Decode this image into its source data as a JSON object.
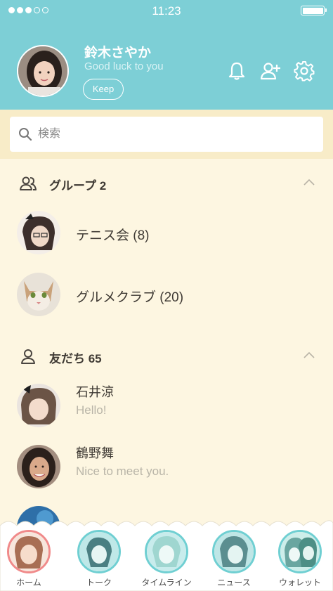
{
  "status_bar": {
    "time": "11:23",
    "signal_filled": 3,
    "signal_total": 5,
    "battery_level": 1.0
  },
  "profile": {
    "name": "鈴木さやか",
    "status_message": "Good luck to you",
    "keep_label": "Keep",
    "icons": [
      "bell-icon",
      "add-friend-icon",
      "gear-icon"
    ]
  },
  "search": {
    "placeholder": "検索",
    "value": ""
  },
  "groups": {
    "header": "グループ 2",
    "items": [
      {
        "label": "テニス会 (8)"
      },
      {
        "label": "グルメクラブ (20)"
      }
    ]
  },
  "friends": {
    "header": "友だち 65",
    "items": [
      {
        "name": "石井涼",
        "message": "Hello!"
      },
      {
        "name": "鶴野舞",
        "message": "Nice to meet you."
      }
    ]
  },
  "bottom_nav": {
    "items": [
      {
        "label": "ホーム",
        "active": true
      },
      {
        "label": "トーク",
        "active": false
      },
      {
        "label": "タイムライン",
        "active": false
      },
      {
        "label": "ニュース",
        "active": false
      },
      {
        "label": "ウォレット",
        "active": false
      }
    ]
  },
  "colors": {
    "header_bg": "#7dcfd6",
    "list_bg": "#fdf6e1",
    "search_band": "#f8ecc8",
    "nav_ring": "#6fcfd2",
    "nav_active_ring": "#f08a8a",
    "text_dark": "#3f3a34",
    "text_muted": "#b9b5a8"
  }
}
